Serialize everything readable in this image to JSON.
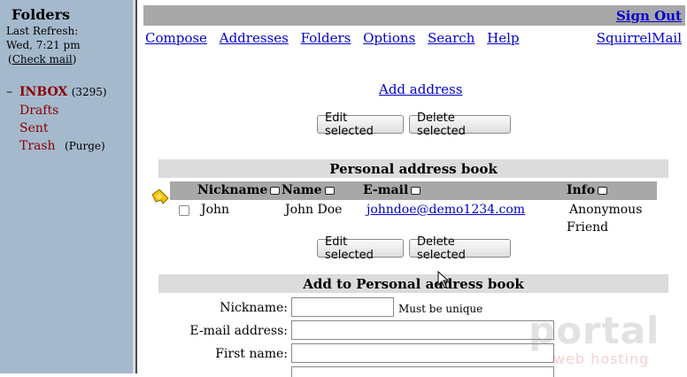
{
  "sidebar": {
    "title": "Folders",
    "last_refresh_label": "Last Refresh:",
    "last_refresh_time": "Wed, 7:21 pm",
    "check_mail_open": "(",
    "check_mail_label": "Check mail",
    "check_mail_close": ")",
    "collapse_symbol": "–",
    "folders": [
      {
        "name": "INBOX",
        "count": "(3295)"
      },
      {
        "name": "Drafts"
      },
      {
        "name": "Sent"
      },
      {
        "name": "Trash",
        "action": "(Purge)"
      }
    ]
  },
  "header": {
    "signout_label": "Sign Out",
    "nav": [
      "Compose",
      "Addresses",
      "Folders",
      "Options",
      "Search",
      "Help"
    ],
    "brand_link": "SquirrelMail"
  },
  "main": {
    "add_address_link": "Add address",
    "edit_selected_label": "Edit selected",
    "delete_selected_label": "Delete selected",
    "personal_book_title": "Personal address book",
    "columns": [
      "Nickname",
      "Name",
      "E-mail",
      "Info"
    ],
    "rows": [
      {
        "nickname": "John",
        "name": "John Doe",
        "email": "johndoe@demo1234.com",
        "info_line1": "Anonymous",
        "info_line2": "Friend"
      }
    ],
    "add_section_title": "Add to Personal address book",
    "form": {
      "nickname_label": "Nickname:",
      "nickname_hint": "Must be unique",
      "email_label": "E-mail address:",
      "firstname_label": "First name:"
    }
  },
  "watermark": {
    "main": "portal",
    "sub": "web hosting"
  }
}
